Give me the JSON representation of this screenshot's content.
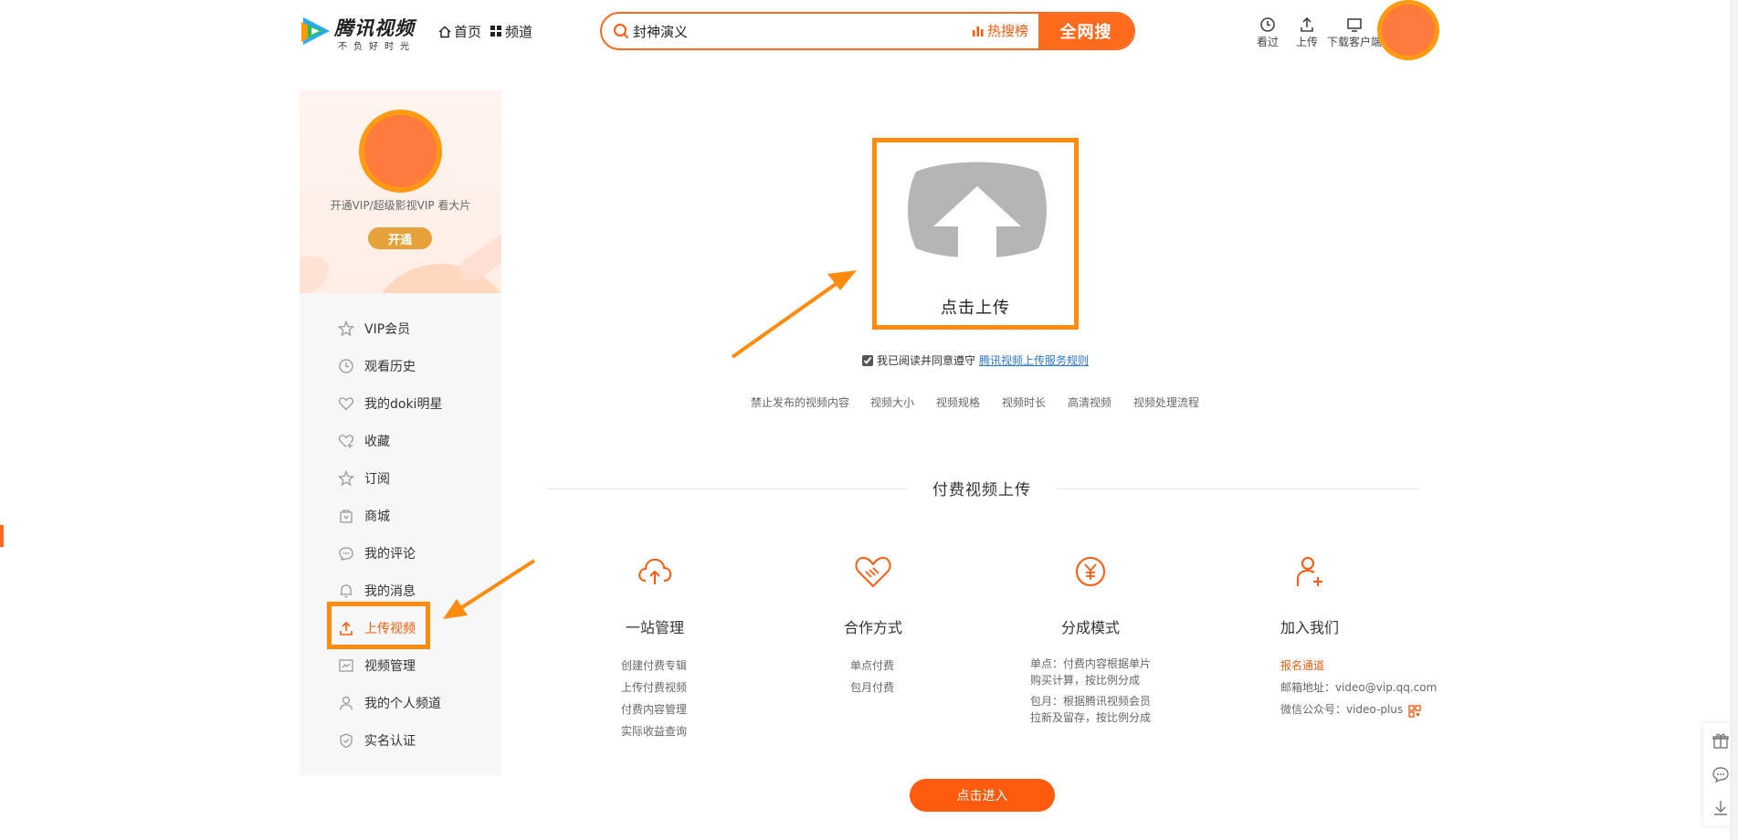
{
  "header": {
    "logo_title": "腾讯视频",
    "logo_slogan": "不负好时光",
    "nav": [
      {
        "label": "首页",
        "icon": "home-icon"
      },
      {
        "label": "频道",
        "icon": "grid-icon"
      }
    ],
    "search": {
      "value": "封神演义",
      "hot_label": "热搜榜",
      "button_label": "全网搜"
    },
    "tools": [
      {
        "label": "看过",
        "icon": "clock-icon"
      },
      {
        "label": "上传",
        "icon": "upload-icon"
      },
      {
        "label": "下载客户端",
        "icon": "monitor-icon"
      }
    ]
  },
  "sidebar": {
    "vip_text": "开通VIP/超级影视VIP 看大片",
    "open_label": "开通",
    "items": [
      {
        "label": "VIP会员",
        "icon": "vip-star-icon"
      },
      {
        "label": "观看历史",
        "icon": "clock-icon"
      },
      {
        "label": "我的doki明星",
        "icon": "heart-icon"
      },
      {
        "label": "收藏",
        "icon": "heart-plus-icon"
      },
      {
        "label": "订阅",
        "icon": "star-icon"
      },
      {
        "label": "商城",
        "icon": "bag-icon"
      },
      {
        "label": "我的评论",
        "icon": "comment-icon"
      },
      {
        "label": "我的消息",
        "icon": "bell-icon"
      },
      {
        "label": "上传视频",
        "icon": "upload-icon",
        "active": true
      },
      {
        "label": "视频管理",
        "icon": "video-manage-icon"
      },
      {
        "label": "我的个人频道",
        "icon": "user-icon"
      },
      {
        "label": "实名认证",
        "icon": "shield-icon"
      }
    ]
  },
  "upload": {
    "label": "点击上传",
    "agree_text": "我已阅读并同意遵守",
    "agree_link": "腾讯视频上传服务规则",
    "agree_checked": true,
    "links": [
      "禁止发布的视频内容",
      "视频大小",
      "视频规格",
      "视频时长",
      "高清视频",
      "视频处理流程"
    ]
  },
  "paid": {
    "title": "付费视频上传",
    "features": [
      {
        "title": "一站管理",
        "icon": "cloud-upload-icon",
        "lines": [
          "创建付费专辑",
          "上传付费视频",
          "付费内容管理",
          "实际收益查询"
        ]
      },
      {
        "title": "合作方式",
        "icon": "handshake-heart-icon",
        "lines": [
          "单点付费",
          "包月付费"
        ]
      },
      {
        "title": "分成模式",
        "icon": "yuan-coin-icon",
        "lines": [
          "单点：付费内容根据单片",
          "购买计算，按比例分成",
          "包月：根据腾讯视频会员",
          "拉新及留存，按比例分成"
        ]
      },
      {
        "title": "加入我们",
        "icon": "user-add-icon",
        "signup": "报名通道",
        "email": "邮箱地址：video@vip.qq.com",
        "wechat": "微信公众号：video-plus"
      }
    ],
    "enter_label": "点击进入"
  },
  "colors": {
    "accent": "#ff6a1c",
    "highlight": "#ff8b0f",
    "link": "#2a75d6",
    "vip_gold": "#e5a23a"
  }
}
